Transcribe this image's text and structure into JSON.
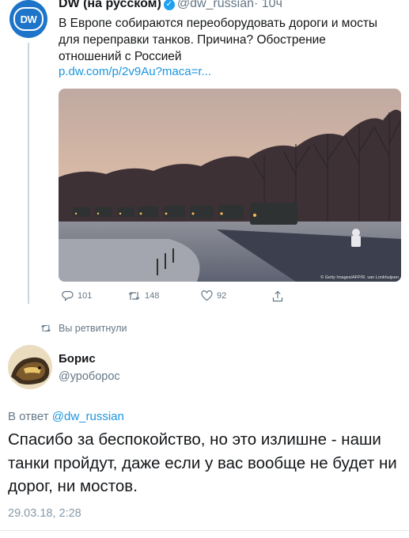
{
  "quoted_tweet": {
    "author_name": "DW (на русском)",
    "handle": "@dw_russian",
    "time": "· 10ч",
    "text": "В Европе собираются переоборудовать дороги и мосты для переправки танков. Причина? Обострение отношений с Россией",
    "link": "p.dw.com/p/2v9Au?maca=r...",
    "avatar_text": "DW",
    "photo_credit": "© Getty Images/AFP/R. van Lonkhuijsen",
    "actions": {
      "replies": "101",
      "retweets": "148",
      "likes": "92"
    }
  },
  "retweet_note": "Вы ретвитнули",
  "reply": {
    "author_name": "Борис",
    "handle": "@уроборос",
    "reply_to_prefix": "В ответ",
    "reply_to_handle": "@dw_russian",
    "text": "Спасибо за беспокойство, но это излишне - наши танки пройдут, даже если у вас вообще не будет ни дорог, ни мостов.",
    "timestamp": "29.03.18, 2:28"
  },
  "colors": {
    "link": "#1b95e0",
    "muted": "#657786",
    "verified": "#1da1f2",
    "dw_blue": "#1d74c9"
  },
  "icons": [
    "verified-badge-icon",
    "reply-icon",
    "retweet-icon",
    "like-icon",
    "share-icon"
  ]
}
